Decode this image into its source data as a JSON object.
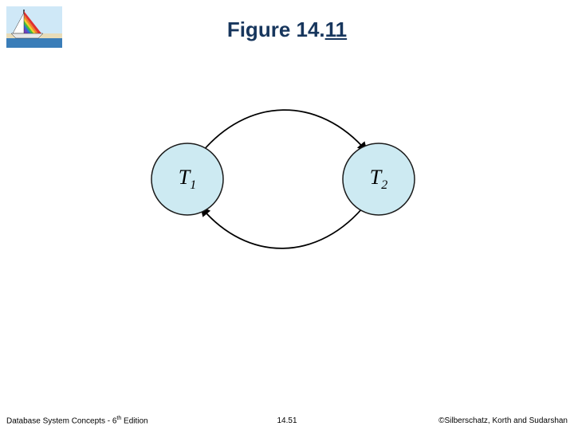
{
  "title": {
    "prefix": "Figure 14.",
    "suffix": "11"
  },
  "diagram": {
    "nodes": [
      {
        "id": "T1",
        "label_base": "T",
        "label_sub": "1"
      },
      {
        "id": "T2",
        "label_base": "T",
        "label_sub": "2"
      }
    ],
    "edges": [
      {
        "from": "T1",
        "to": "T2"
      },
      {
        "from": "T2",
        "to": "T1"
      }
    ]
  },
  "footer": {
    "left_prefix": "Database System Concepts - 6",
    "left_sup": "th",
    "left_suffix": " Edition",
    "center": "14.51",
    "right": "©Silberschatz, Korth and Sudarshan"
  }
}
